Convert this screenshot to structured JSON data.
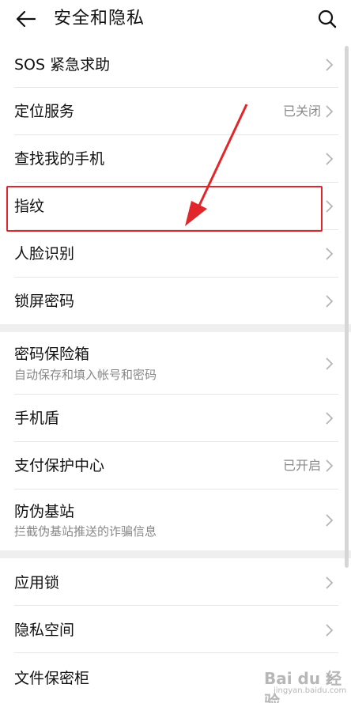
{
  "header": {
    "title": "安全和隐私",
    "back_icon": "arrow-left-icon",
    "search_icon": "search-icon"
  },
  "section1": {
    "items": [
      {
        "title": "SOS 紧急求助",
        "value": ""
      },
      {
        "title": "定位服务",
        "value": "已关闭"
      },
      {
        "title": "查找我的手机",
        "value": ""
      },
      {
        "title": "指纹",
        "value": ""
      },
      {
        "title": "人脸识别",
        "value": ""
      },
      {
        "title": "锁屏密码",
        "value": ""
      }
    ]
  },
  "section2": {
    "items": [
      {
        "title": "密码保险箱",
        "subtitle": "自动保存和填入帐号和密码",
        "value": ""
      },
      {
        "title": "手机盾",
        "subtitle": "",
        "value": ""
      },
      {
        "title": "支付保护中心",
        "subtitle": "",
        "value": "已开启"
      },
      {
        "title": "防伪基站",
        "subtitle": "拦截伪基站推送的诈骗信息",
        "value": ""
      }
    ]
  },
  "section3": {
    "items": [
      {
        "title": "应用锁"
      },
      {
        "title": "隐私空间"
      },
      {
        "title": "文件保密柜"
      }
    ]
  },
  "watermark": {
    "brand": "Bai du 经验",
    "sub": "jingyan.baidu.com"
  },
  "colors": {
    "highlight": "#e0262b",
    "text_primary": "#111111",
    "text_secondary": "#888888",
    "divider": "#e6e6e6",
    "section_gap": "#efefef"
  }
}
